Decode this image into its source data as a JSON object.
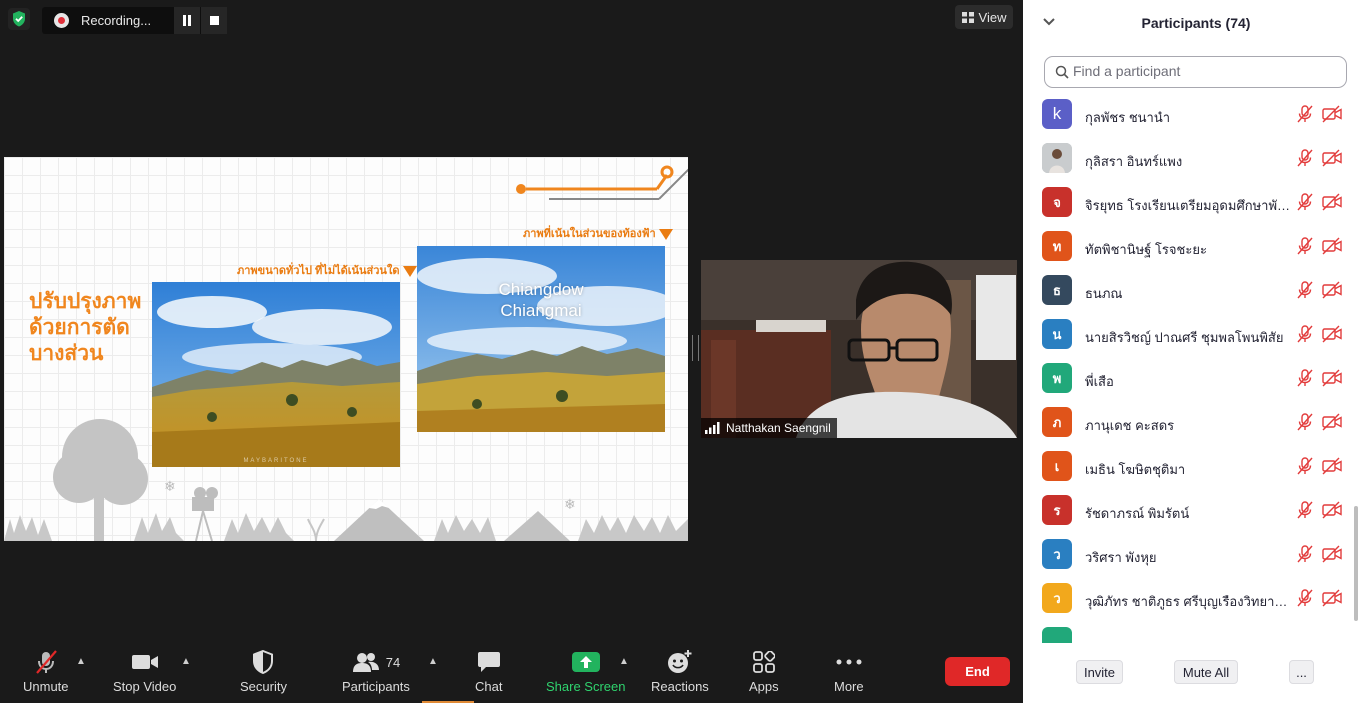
{
  "recording": {
    "label": "Recording..."
  },
  "view_button": {
    "label": "View"
  },
  "slide": {
    "title_lines": [
      "ปรับปรุงภาพ",
      "ด้วยการตัด",
      "บางส่วน"
    ],
    "caption_left": "ภาพขนาดทั่วไป ที่ไม่ได้เน้นส่วนใด",
    "caption_right": "ภาพที่เน้นในส่วนของท้องฟ้า",
    "overlay_lines": [
      "Chiangdow",
      "Chiangmai"
    ],
    "watermark": "MAYBARITONE"
  },
  "camera": {
    "name": "Natthakan Saengnil"
  },
  "toolbar": {
    "unmute": "Unmute",
    "stop_video": "Stop Video",
    "security": "Security",
    "participants": "Participants",
    "participants_count": "74",
    "chat": "Chat",
    "share_screen": "Share Screen",
    "reactions": "Reactions",
    "apps": "Apps",
    "more": "More",
    "end": "End"
  },
  "panel": {
    "title": "Participants (74)",
    "search_placeholder": "Find a participant",
    "participants": [
      {
        "initial": "k",
        "name": "กุลพัชร ชนานำ",
        "color": "#5b5fc7"
      },
      {
        "initial": "",
        "name": "กุลิสรา อินทร์แพง",
        "color": "#9aa3a8"
      },
      {
        "initial": "จ",
        "name": "จิรยุทธ โรงเรียนเตรียมอุดมศึกษาพัฒ...",
        "color": "#c8312b"
      },
      {
        "initial": "ท",
        "name": "ทัตพิชานิษฐ์ โรจชะยะ",
        "color": "#e0541a"
      },
      {
        "initial": "ธ",
        "name": "ธนภณ",
        "color": "#34495e"
      },
      {
        "initial": "น",
        "name": "นายสิรวิชญ์ ปาณศรี ชุมพลโพนพิสัย",
        "color": "#2a7fc1"
      },
      {
        "initial": "พ",
        "name": "พี่เสือ",
        "color": "#21a87a"
      },
      {
        "initial": "ภ",
        "name": "ภานุเดช คะสดร",
        "color": "#e0541a"
      },
      {
        "initial": "เ",
        "name": "เมธิน โฆษิตชุติมา",
        "color": "#e0541a"
      },
      {
        "initial": "ร",
        "name": "รัชดาภรณ์ พิมรัตน์",
        "color": "#c8312b"
      },
      {
        "initial": "ว",
        "name": "วริศรา พังหุย",
        "color": "#2a7fc1"
      },
      {
        "initial": "ว",
        "name": "วุฒิภัทร ชาติภูธร ศรีบุญเรืองวิทยาคาร",
        "color": "#f2a81c"
      },
      {
        "initial": "",
        "name": "",
        "color": "#21a87a"
      }
    ],
    "invite": "Invite",
    "mute_all": "Mute All",
    "more": "..."
  }
}
